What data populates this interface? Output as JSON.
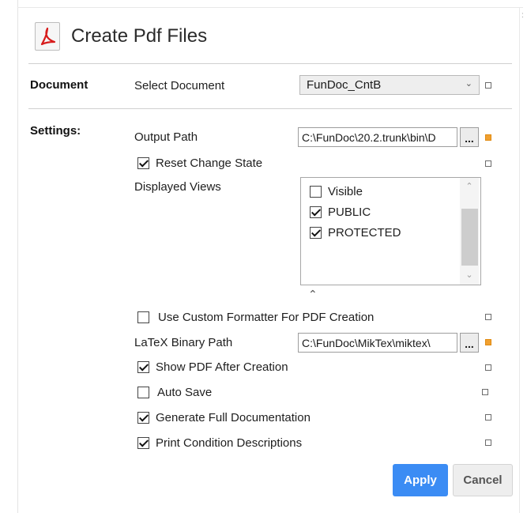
{
  "header": {
    "title": "Create Pdf Files",
    "icon": "pdf-icon",
    "icon_color": "#d71b1b"
  },
  "document_section": {
    "label": "Document",
    "select_label": "Select Document",
    "select_value": "FunDoc_CntB"
  },
  "settings_section": {
    "label": "Settings:",
    "output_path_label": "Output Path",
    "output_path_value": "C:\\FunDoc\\20.2.trunk\\bin\\D",
    "browse_label": "...",
    "reset_change_state": {
      "label": "Reset Change State",
      "checked": true
    },
    "displayed_views_label": "Displayed Views",
    "views": [
      {
        "label": "Visible",
        "checked": false
      },
      {
        "label": "PUBLIC",
        "checked": true
      },
      {
        "label": "PROTECTED",
        "checked": true
      }
    ],
    "custom_formatter": {
      "label": "Use Custom Formatter For PDF Creation",
      "checked": false
    },
    "latex_label": "LaTeX Binary Path",
    "latex_value": "C:\\FunDoc\\MikTex\\miktex\\",
    "show_pdf": {
      "label": "Show PDF After Creation",
      "checked": true
    },
    "auto_save": {
      "label": "Auto Save",
      "checked": false
    },
    "full_doc": {
      "label": "Generate Full Documentation",
      "checked": true
    },
    "print_conditions": {
      "label": "Print Condition Descriptions",
      "checked": true
    }
  },
  "buttons": {
    "apply": "Apply",
    "cancel": "Cancel"
  },
  "colors": {
    "accent": "#3b8cf4",
    "modified_marker": "#f0a030"
  }
}
